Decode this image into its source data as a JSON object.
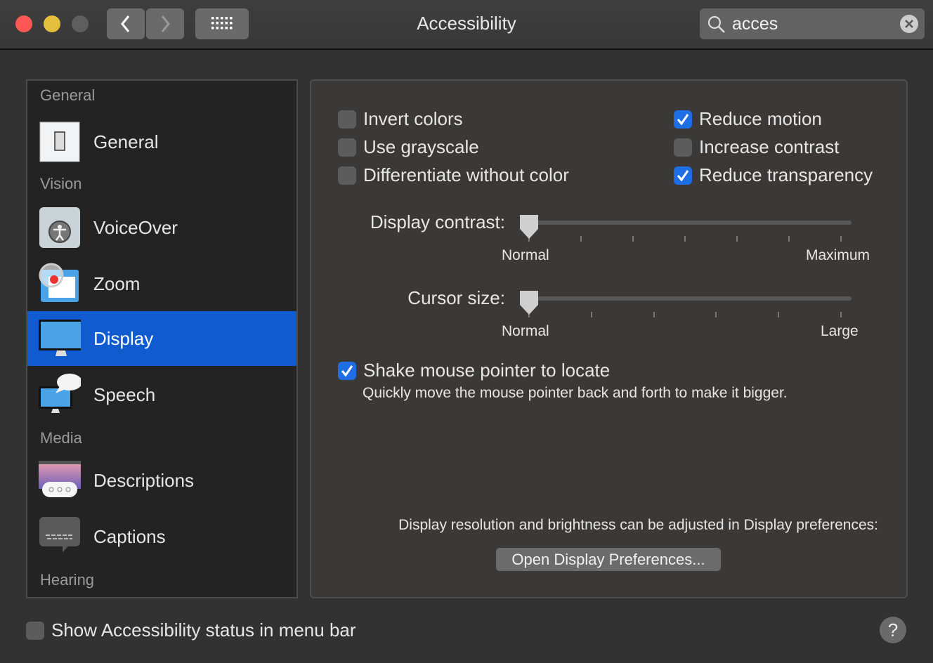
{
  "window": {
    "title": "Accessibility"
  },
  "search": {
    "value": "acces"
  },
  "sidebar": {
    "sections": [
      "General",
      "Vision",
      "Media",
      "Hearing"
    ],
    "items": [
      {
        "label": "General",
        "icon": "switch-icon"
      },
      {
        "label": "VoiceOver",
        "icon": "voiceover-icon"
      },
      {
        "label": "Zoom",
        "icon": "zoom-icon"
      },
      {
        "label": "Display",
        "icon": "display-icon",
        "selected": true
      },
      {
        "label": "Speech",
        "icon": "speech-icon"
      },
      {
        "label": "Descriptions",
        "icon": "descriptions-icon"
      },
      {
        "label": "Captions",
        "icon": "captions-icon"
      }
    ]
  },
  "display": {
    "checkboxes": [
      {
        "label": "Invert colors",
        "checked": false
      },
      {
        "label": "Use grayscale",
        "checked": false
      },
      {
        "label": "Differentiate without color",
        "checked": false
      },
      {
        "label": "Reduce motion",
        "checked": true
      },
      {
        "label": "Increase contrast",
        "checked": false
      },
      {
        "label": "Reduce transparency",
        "checked": true
      }
    ],
    "contrast": {
      "label": "Display contrast:",
      "min_label": "Normal",
      "max_label": "Maximum",
      "value": 0
    },
    "cursor": {
      "label": "Cursor size:",
      "min_label": "Normal",
      "max_label": "Large",
      "value": 0
    },
    "shake": {
      "label": "Shake mouse pointer to locate",
      "checked": true,
      "description": "Quickly move the mouse pointer back and forth to make it bigger."
    },
    "note": "Display resolution and brightness can be adjusted in Display preferences:",
    "open_button": "Open Display Preferences..."
  },
  "footer": {
    "status_label": "Show Accessibility status in menu bar",
    "status_checked": false,
    "help": "?"
  },
  "colors": {
    "accent": "#0f5bcf",
    "checkbox_on": "#1f6ee6"
  }
}
